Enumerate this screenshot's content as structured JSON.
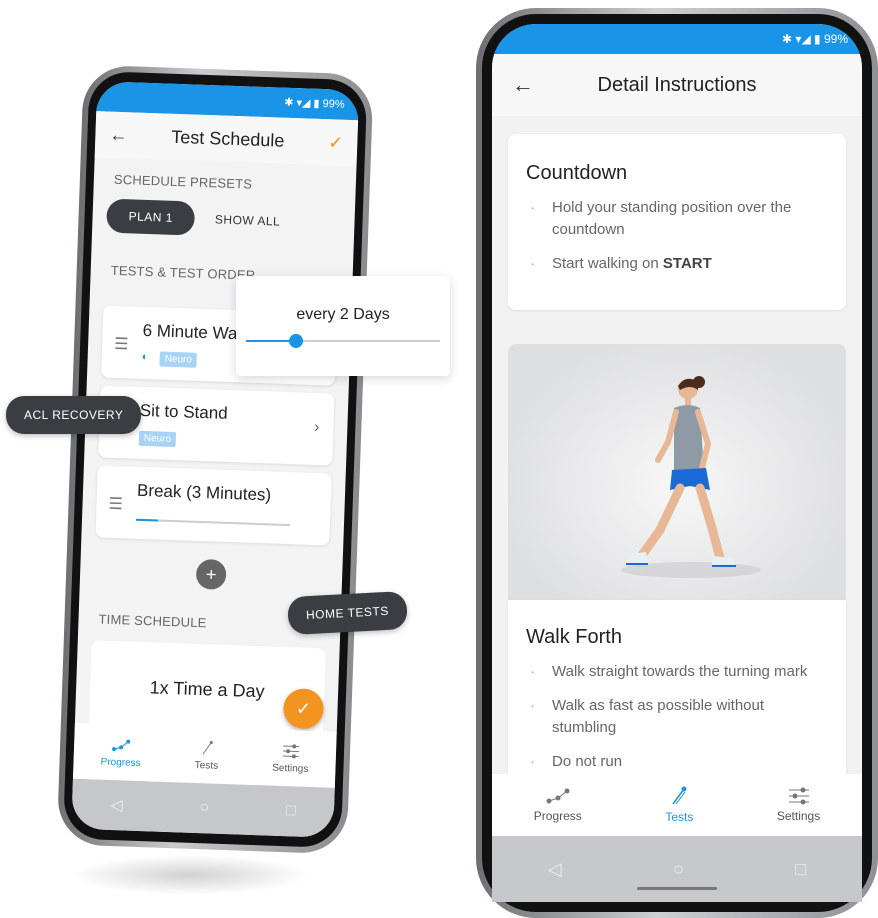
{
  "left_phone": {
    "status": "99%",
    "header": {
      "title": "Test Schedule",
      "back_icon": "arrow-left-icon",
      "confirm_icon": "check-icon"
    },
    "schedule_presets": {
      "label": "SCHEDULE PRESETS",
      "active_preset": "PLAN 1",
      "show_all": "SHOW ALL"
    },
    "tests_section_label": "TESTS & TEST ORDER",
    "tests": [
      {
        "title": "6 Minute Walk",
        "tag": "Neuro"
      },
      {
        "title": "Sit to Stand",
        "tag": "Neuro"
      },
      {
        "title": "Break (3 Minutes)",
        "progress": 0.14
      }
    ],
    "time_schedule": {
      "label": "TIME SCHEDULE",
      "value": "1x Time a Day"
    },
    "bottom_nav": [
      {
        "label": "Progress",
        "active": true
      },
      {
        "label": "Tests",
        "active": false
      },
      {
        "label": "Settings",
        "active": false
      }
    ]
  },
  "overlays": {
    "interval": {
      "prefix": "every ",
      "value": "2 Days",
      "slider_value": 0.26
    },
    "acl_chip": "ACL RECOVERY",
    "home_tests_chip": "HOME TESTS"
  },
  "right_phone": {
    "status": "99%",
    "header": {
      "title": "Detail Instructions",
      "back_icon": "arrow-left-icon"
    },
    "countdown": {
      "title": "Countdown",
      "items": [
        {
          "text": "Hold your standing position over the countdown"
        },
        {
          "text_prefix": "Start walking on ",
          "text_bold": "START"
        }
      ]
    },
    "walk_forth": {
      "title": "Walk Forth",
      "items": [
        "Walk straight towards the turning mark",
        "Walk as fast as possible without stumbling",
        "Do not run"
      ]
    },
    "bottom_nav": [
      {
        "label": "Progress",
        "active": false
      },
      {
        "label": "Tests",
        "active": true
      },
      {
        "label": "Settings",
        "active": false
      }
    ]
  },
  "colors": {
    "accent": "#1a94e6",
    "fab": "#f39320",
    "chip": "#3a3d42"
  }
}
